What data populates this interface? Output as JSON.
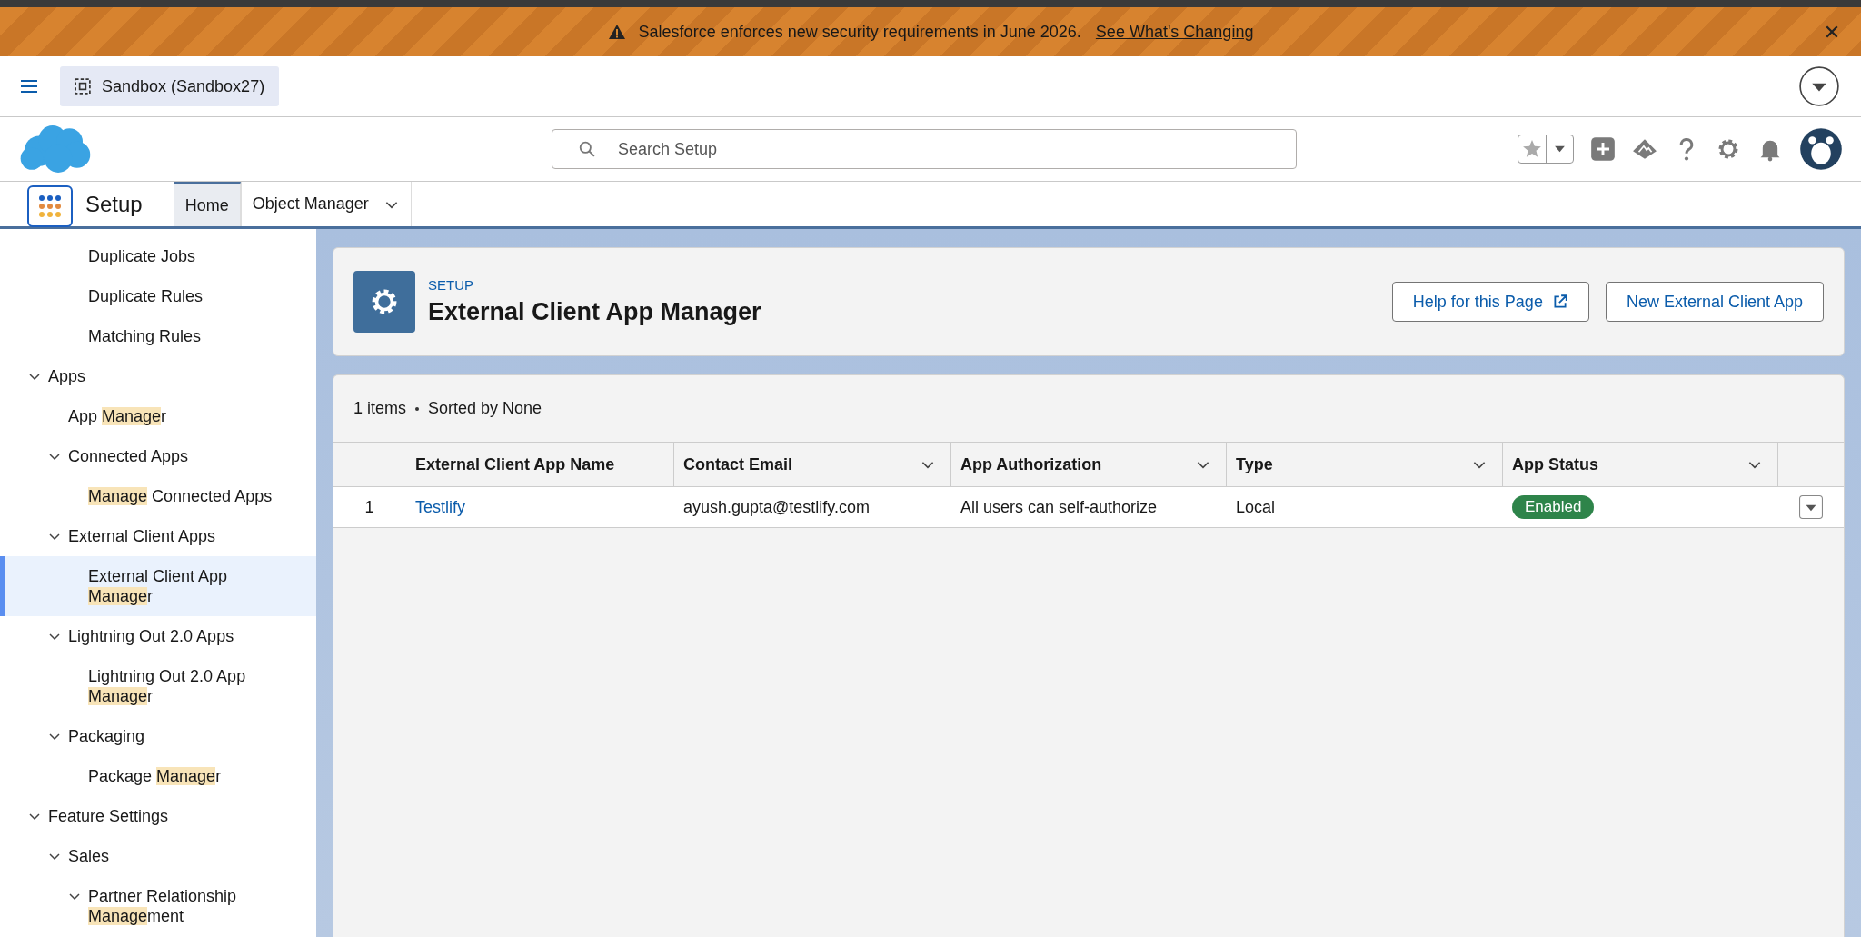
{
  "banner": {
    "message": "Salesforce enforces new security requirements in June 2026.",
    "link": "See What's Changing"
  },
  "env_bar": {
    "org": "Sandbox (Sandbox27)"
  },
  "search": {
    "placeholder": "Search Setup"
  },
  "nav": {
    "app_name": "Setup",
    "tabs": [
      {
        "label": "Home",
        "selected": true,
        "kind": "plain"
      },
      {
        "label": "Object Manager",
        "selected": false,
        "kind": "menu"
      }
    ]
  },
  "sidebar": {
    "continued_items": [
      {
        "label": "Duplicate Jobs",
        "selected": false
      },
      {
        "label": "Duplicate Rules",
        "selected": false
      },
      {
        "label": "Matching Rules",
        "selected": false
      }
    ],
    "tree": [
      {
        "label": "Apps",
        "expanded": true,
        "selected": false,
        "children": [
          {
            "label": "App **Manage**r",
            "selected": false
          },
          {
            "label": "Connected Apps",
            "expanded": true,
            "selected": false,
            "children": [
              {
                "label": "**Manage** Connected Apps",
                "selected": false
              }
            ]
          },
          {
            "label": "External Client Apps",
            "expanded": true,
            "selected": false,
            "children": [
              {
                "label": "External Client App **Manage**r",
                "selected": true
              }
            ]
          },
          {
            "label": "Lightning Out 2.0 Apps",
            "expanded": true,
            "selected": false,
            "children": [
              {
                "label": "Lightning Out 2.0 App **Manage**r",
                "selected": false
              }
            ]
          },
          {
            "label": "Packaging",
            "expanded": true,
            "selected": false,
            "children": [
              {
                "label": "Package **Manage**r",
                "selected": false
              }
            ]
          }
        ]
      },
      {
        "label": "Feature Settings",
        "expanded": true,
        "selected": false,
        "children": [
          {
            "label": "Sales",
            "expanded": true,
            "selected": false,
            "children": [
              {
                "label": "Partner Relationship **Manage**ment",
                "expanded": true,
                "selected": false
              }
            ]
          }
        ]
      }
    ]
  },
  "page_header": {
    "eyebrow": "SETUP",
    "title": "External Client App Manager",
    "buttons": [
      {
        "label": "Help for this Page",
        "kind": "external"
      },
      {
        "label": "New External Client App",
        "kind": "plain"
      }
    ]
  },
  "list": {
    "summary": "1 items",
    "sort": "Sorted by None",
    "columns": [
      {
        "label": "External Client App Name",
        "menu": false
      },
      {
        "label": "Contact Email",
        "menu": true
      },
      {
        "label": "App Authorization",
        "menu": true
      },
      {
        "label": "Type",
        "menu": true
      },
      {
        "label": "App Status",
        "menu": true
      }
    ],
    "rows": [
      {
        "number": "1",
        "name": "Testlify",
        "email": "ayush.gupta@testlify.com",
        "authorization": "All users can self-authorize",
        "type": "Local",
        "status": "Enabled"
      }
    ]
  }
}
